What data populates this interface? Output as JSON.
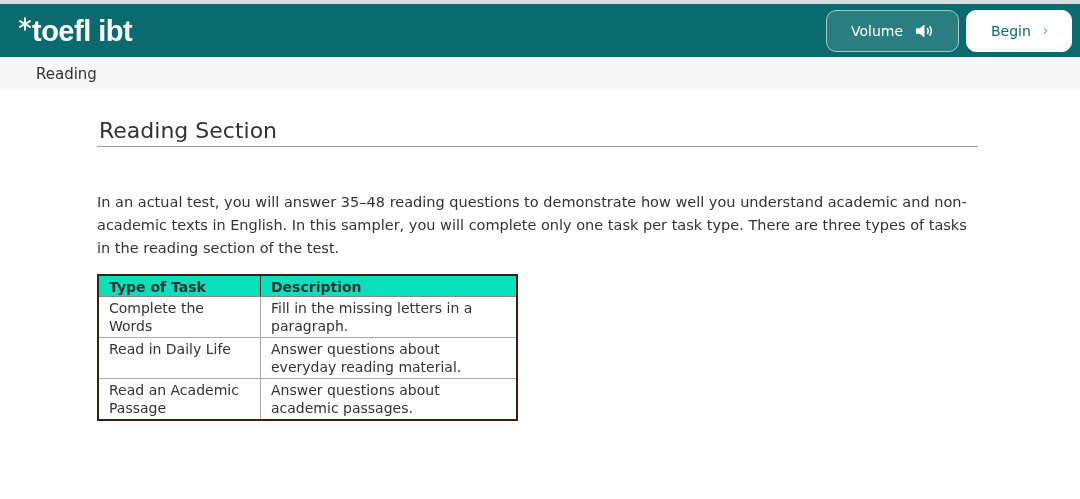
{
  "header": {
    "logo": "toefl ibt",
    "buttons": [
      {
        "label": "Volume",
        "kind": "volume"
      },
      {
        "label": "Begin",
        "kind": "begin"
      }
    ]
  },
  "section_bar": {
    "label": "Reading"
  },
  "content": {
    "title": "Reading Section",
    "paragraph": "In an actual test, you will answer 35–48 reading questions to demonstrate how well you understand academic and non-academic texts in English. In this sampler, you will complete only one task per task type. There are three types of tasks in the reading section of the test.",
    "table": {
      "columns": [
        "Type of Task",
        "Description"
      ],
      "rows": [
        [
          "Complete the Words",
          "Fill in the missing letters in a paragraph."
        ],
        [
          "Read in Daily Life",
          "Answer questions about everyday reading material."
        ],
        [
          "Read an Academic Passage",
          "Answer questions about academic passages."
        ]
      ]
    }
  }
}
